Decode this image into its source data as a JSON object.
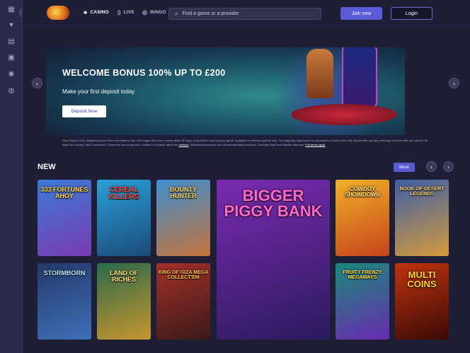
{
  "sidebar": {
    "collapse_icon": "chevron-right-icon",
    "items": [
      {
        "icon": "grid-icon",
        "glyph": "▦"
      },
      {
        "icon": "heart-icon",
        "glyph": "♥"
      },
      {
        "icon": "wallet-icon",
        "glyph": "▤"
      },
      {
        "icon": "gift-icon",
        "glyph": "▣"
      },
      {
        "icon": "shield-icon",
        "glyph": "◉"
      },
      {
        "icon": "chat-icon",
        "glyph": "◍"
      }
    ]
  },
  "header": {
    "nav": [
      {
        "label": "CASINO",
        "icon": "spade-icon",
        "glyph": "♣"
      },
      {
        "label": "LIVE",
        "icon": "card-icon",
        "glyph": "▯"
      },
      {
        "label": "BINGO",
        "icon": "bingo-icon",
        "glyph": "◎"
      }
    ],
    "trophy_icon": "trophy-icon",
    "search_placeholder": "Find a game or a provider",
    "join_label": "Join now",
    "login_label": "Login"
  },
  "banner": {
    "title": "WELCOME BONUS 100% UP TO £200",
    "subtitle": "Make your first deposit today",
    "cta_label": "Deposit Now"
  },
  "terms": {
    "text": "New Players Only. Wagering occurs from real balance first. 50X wager the bonus money within 30 days. Contribution may vary per game. Available on selected games only. The wagering requirement is calculated on bonus bets only. Bonus offer and any winnings from the offer are valid for 30 days from receipt. Max conversion: 3 times the bonus amount. Limited to 5 brands within the",
    "link1": "network",
    "text2": ". Withdrawal requests void all active/pending bonuses. Excluded Skrill and Neteller deposits.",
    "link2": "Full terms apply"
  },
  "section": {
    "title": "NEW",
    "more_label": "More"
  },
  "games": [
    {
      "title": "333 FORTUNES AHOY",
      "bg1": "#3a7ad8",
      "bg2": "#7a3bb0",
      "fc": "#ffd84a"
    },
    {
      "title": "CEREAL KILLERS",
      "bg1": "#2aa0d8",
      "bg2": "#1b4a78",
      "fc": "#ff4a4a"
    },
    {
      "title": "BOUNTY HUNTER",
      "bg1": "#3f8fd0",
      "bg2": "#c4733a",
      "fc": "#ffd36b"
    },
    {
      "title": "BIGGER PIGGY BANK",
      "bg1": "#7a2bb0",
      "bg2": "#2a1a5e",
      "fc": "#ff69c8"
    },
    {
      "title": "COWBOY SHOWDOWN",
      "bg1": "#f0b02a",
      "bg2": "#c6431b",
      "fc": "#ffe27a"
    },
    {
      "title": "BOOK OF DESERT LEGENDS",
      "bg1": "#3c5fa8",
      "bg2": "#d49a3c",
      "fc": "#ffd47a"
    },
    {
      "title": "STORMBORN",
      "bg1": "#233a6a",
      "bg2": "#3f6fb8",
      "fc": "#bfe4ff"
    },
    {
      "title": "LAND OF RICHES",
      "bg1": "#2a6a4a",
      "bg2": "#c8962e",
      "fc": "#ffe07a"
    },
    {
      "title": "KING OF GIZA MEGA COLLECT'EM",
      "bg1": "#a3302a",
      "bg2": "#3a1a18",
      "fc": "#ffc84a"
    },
    {
      "title": "FRUITY FRENZY MEGAWAYS",
      "bg1": "#1a8a7a",
      "bg2": "#6a2ab0",
      "fc": "#ffe04a"
    },
    {
      "title": "MULTI COINS",
      "bg1": "#c0330e",
      "bg2": "#3a0a06",
      "fc": "#ffd23a"
    }
  ]
}
